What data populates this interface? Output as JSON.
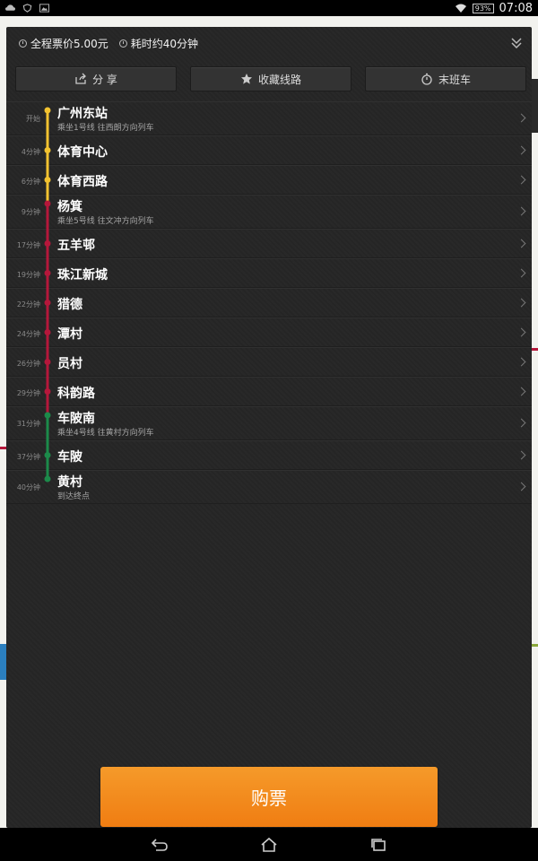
{
  "status_bar": {
    "battery": "93%",
    "time": "07:08"
  },
  "summary": {
    "fare": "全程票价5.00元",
    "duration": "耗时约40分钟"
  },
  "actions": {
    "share": "分 享",
    "favorite": "收藏线路",
    "last_train": "末班车"
  },
  "stops": [
    {
      "time": "开始",
      "name": "广州东站",
      "note": "乘坐1号线 往西朗方向列车",
      "line_color": "#f2c230"
    },
    {
      "time": "4分钟",
      "name": "体育中心",
      "note": "",
      "line_color": "#f2c230"
    },
    {
      "time": "6分钟",
      "name": "体育西路",
      "note": "",
      "line_color": "#f2c230"
    },
    {
      "time": "9分钟",
      "name": "杨箕",
      "note": "乘坐5号线 往文冲方向列车",
      "line_color": "#b5173b"
    },
    {
      "time": "17分钟",
      "name": "五羊邨",
      "note": "",
      "line_color": "#b5173b"
    },
    {
      "time": "19分钟",
      "name": "珠江新城",
      "note": "",
      "line_color": "#b5173b"
    },
    {
      "time": "22分钟",
      "name": "猎德",
      "note": "",
      "line_color": "#b5173b"
    },
    {
      "time": "24分钟",
      "name": "潭村",
      "note": "",
      "line_color": "#b5173b"
    },
    {
      "time": "26分钟",
      "name": "员村",
      "note": "",
      "line_color": "#b5173b"
    },
    {
      "time": "29分钟",
      "name": "科韵路",
      "note": "",
      "line_color": "#b5173b"
    },
    {
      "time": "31分钟",
      "name": "车陂南",
      "note": "乘坐4号线 往黄村方向列车",
      "line_color": "#1c8a4a"
    },
    {
      "time": "37分钟",
      "name": "车陂",
      "note": "",
      "line_color": "#1c8a4a"
    },
    {
      "time": "40分钟",
      "name": "黄村",
      "note": "到达终点",
      "line_color": "#1c8a4a"
    }
  ],
  "buy_button": "购票",
  "colors": {
    "line1": "#f2c230",
    "line5": "#b5173b",
    "line4": "#1c8a4a",
    "buy": "#f07d12"
  }
}
